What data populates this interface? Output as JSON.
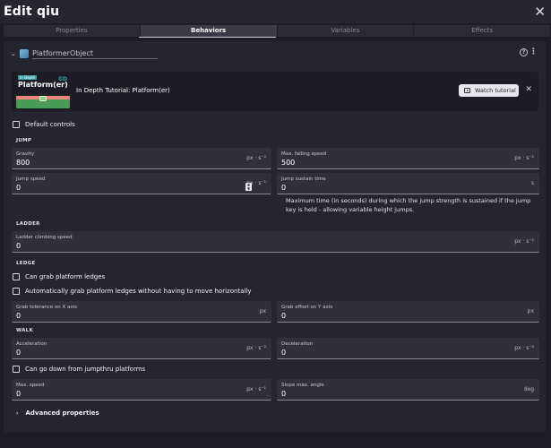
{
  "window": {
    "title": "Edit qiu",
    "close": "✕"
  },
  "tabs": [
    {
      "label": "Properties"
    },
    {
      "label": "Behaviors"
    },
    {
      "label": "Variables"
    },
    {
      "label": "Effects"
    }
  ],
  "behavior": {
    "name": "PlatformerObject",
    "help": "?",
    "menu": "⋮",
    "collapse": "⌄"
  },
  "tutorial": {
    "thumb_tag": "In Depth",
    "thumb_title": "Platform(er)",
    "thumb_logo": "GD",
    "text": "In Depth Tutorial: Platform(er)",
    "watch_label": "Watch tutorial",
    "close": "✕"
  },
  "default_controls": "Default controls",
  "sections": {
    "jump": "JUMP",
    "ladder": "LADDER",
    "ledge": "LEDGE",
    "walk": "WALK"
  },
  "fields": {
    "gravity": {
      "label": "Gravity",
      "value": "800",
      "unit": "px · s⁻²"
    },
    "max_falling": {
      "label": "Max. falling speed",
      "value": "500",
      "unit": "px · s⁻¹"
    },
    "jump_speed": {
      "label": "Jump speed",
      "value": "0",
      "unit": "px · s⁻¹"
    },
    "jump_sustain": {
      "label": "Jump sustain time",
      "value": "0",
      "unit": "s"
    },
    "ladder_speed": {
      "label": "Ladder climbing speed",
      "value": "0",
      "unit": "px · s⁻¹"
    },
    "grab_x": {
      "label": "Grab tolerance on X axis",
      "value": "0",
      "unit": "px"
    },
    "grab_y": {
      "label": "Grab offset on Y axis",
      "value": "0",
      "unit": "px"
    },
    "accel": {
      "label": "Acceleration",
      "value": "0",
      "unit": "px · s⁻²"
    },
    "decel": {
      "label": "Deceleration",
      "value": "0",
      "unit": "px · s⁻²"
    },
    "max_speed": {
      "label": "Max. speed",
      "value": "0",
      "unit": "px · s⁻¹"
    },
    "slope": {
      "label": "Slope max. angle",
      "value": "0",
      "unit": "deg"
    }
  },
  "jump_sustain_desc": "Maximum time (in seconds) during which the jump strength is sustained if the jump key is held - allowing variable height jumps.",
  "checks": {
    "can_grab": "Can grab platform ledges",
    "auto_grab": "Automatically grab platform ledges without having to move horizontally",
    "jumpthru": "Can go down from jumpthru platforms"
  },
  "advanced": {
    "label": "Advanced properties",
    "chevron": "›"
  },
  "stepper": {
    "up": "▲",
    "down": "▼"
  }
}
